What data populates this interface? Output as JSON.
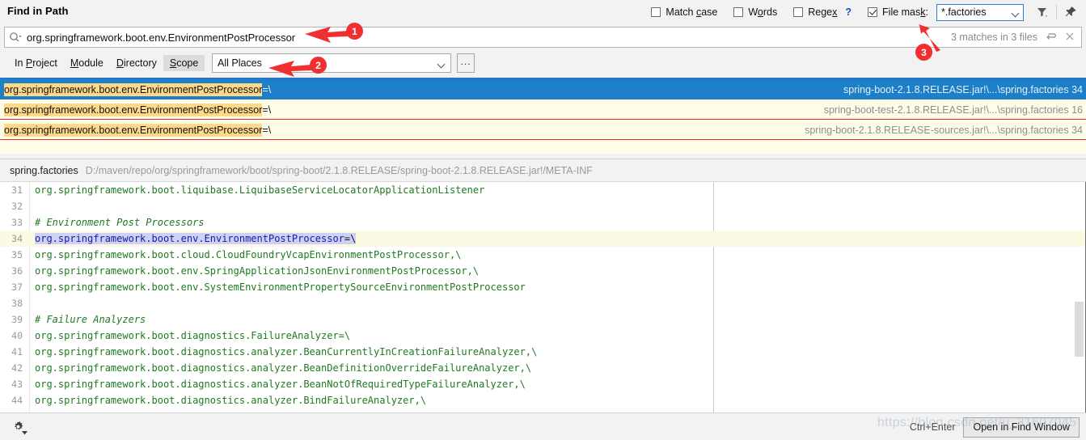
{
  "window": {
    "title": "Find in Path"
  },
  "options": {
    "match_case": {
      "label": "Match case",
      "checked": false
    },
    "words": {
      "label": "Words",
      "checked": false
    },
    "regex": {
      "label": "Regex",
      "checked": false,
      "help": "?"
    },
    "file_mask": {
      "label": "File mask:",
      "checked": true,
      "value": "*.factories"
    },
    "filter_icon": "filter-icon",
    "pin_icon": "pin-icon"
  },
  "search": {
    "icon": "search-icon",
    "value": "org.springframework.boot.env.EnvironmentPostProcessor",
    "placeholder": "Search",
    "match_info": "3 matches in 3 files",
    "rerun_icon": "rerun-icon",
    "close_icon": "close-icon"
  },
  "scope": {
    "tabs": [
      {
        "label": "In Project",
        "selected": false
      },
      {
        "label": "Module",
        "selected": false
      },
      {
        "label": "Directory",
        "selected": false
      },
      {
        "label": "Scope",
        "selected": true
      }
    ],
    "places_value": "All Places",
    "ellipsis_label": "..."
  },
  "results": [
    {
      "match": "org.springframework.boot.env.EnvironmentPostProcessor",
      "tail": "=\\",
      "path": "spring-boot-2.1.8.RELEASE.jar!\\...\\spring.factories 34",
      "selected": true
    },
    {
      "match": "org.springframework.boot.env.EnvironmentPostProcessor",
      "tail": "=\\",
      "path": "spring-boot-test-2.1.8.RELEASE.jar!\\...\\spring.factories 16",
      "selected": false
    },
    {
      "match": "org.springframework.boot.env.EnvironmentPostProcessor",
      "tail": "=\\",
      "path": "spring-boot-2.1.8.RELEASE-sources.jar!\\...\\spring.factories 34",
      "selected": false
    }
  ],
  "preview": {
    "file_name": "spring.factories",
    "file_path": "D:/maven/repo/org/springframework/boot/spring-boot/2.1.8.RELEASE/spring-boot-2.1.8.RELEASE.jar!/META-INF",
    "lines": [
      {
        "num": "31",
        "kind": "value",
        "text": "org.springframework.boot.liquibase.LiquibaseServiceLocatorApplicationListener",
        "highlight": false
      },
      {
        "num": "32",
        "kind": "blank",
        "text": "",
        "highlight": false
      },
      {
        "num": "33",
        "kind": "comment",
        "text": "# Environment Post Processors",
        "highlight": false
      },
      {
        "num": "34",
        "kind": "match",
        "key": "org.springframework.boot.env.EnvironmentPostProcessor",
        "text": "=\\",
        "highlight": true
      },
      {
        "num": "35",
        "kind": "value",
        "text": "org.springframework.boot.cloud.CloudFoundryVcapEnvironmentPostProcessor,\\",
        "highlight": false
      },
      {
        "num": "36",
        "kind": "value",
        "text": "org.springframework.boot.env.SpringApplicationJsonEnvironmentPostProcessor,\\",
        "highlight": false
      },
      {
        "num": "37",
        "kind": "value",
        "text": "org.springframework.boot.env.SystemEnvironmentPropertySourceEnvironmentPostProcessor",
        "highlight": false
      },
      {
        "num": "38",
        "kind": "blank",
        "text": "",
        "highlight": false
      },
      {
        "num": "39",
        "kind": "comment",
        "text": "# Failure Analyzers",
        "highlight": false
      },
      {
        "num": "40",
        "kind": "key",
        "text": "org.springframework.boot.diagnostics.FailureAnalyzer=\\",
        "highlight": false
      },
      {
        "num": "41",
        "kind": "value",
        "text": "org.springframework.boot.diagnostics.analyzer.BeanCurrentlyInCreationFailureAnalyzer,\\",
        "highlight": false
      },
      {
        "num": "42",
        "kind": "value",
        "text": "org.springframework.boot.diagnostics.analyzer.BeanDefinitionOverrideFailureAnalyzer,\\",
        "highlight": false
      },
      {
        "num": "43",
        "kind": "value",
        "text": "org.springframework.boot.diagnostics.analyzer.BeanNotOfRequiredTypeFailureAnalyzer,\\",
        "highlight": false
      },
      {
        "num": "44",
        "kind": "value",
        "text": "org.springframework.boot.diagnostics.analyzer.BindFailureAnalyzer,\\",
        "highlight": false
      }
    ]
  },
  "bottom": {
    "gear_icon": "gear-icon",
    "shortcut_hint": "Ctrl+Enter",
    "open_button": "Open in Find Window"
  },
  "annotations": {
    "badge1": "1",
    "badge2": "2",
    "badge3": "3"
  },
  "watermark": "https://blog.csdn.net/u_31607045",
  "colors": {
    "selection_blue": "#1d7fc7",
    "highlight_yellow": "#ffd98a",
    "result_bg": "#fffce8",
    "annotation_red": "#f03030",
    "accent_border": "#2a7fd4"
  }
}
